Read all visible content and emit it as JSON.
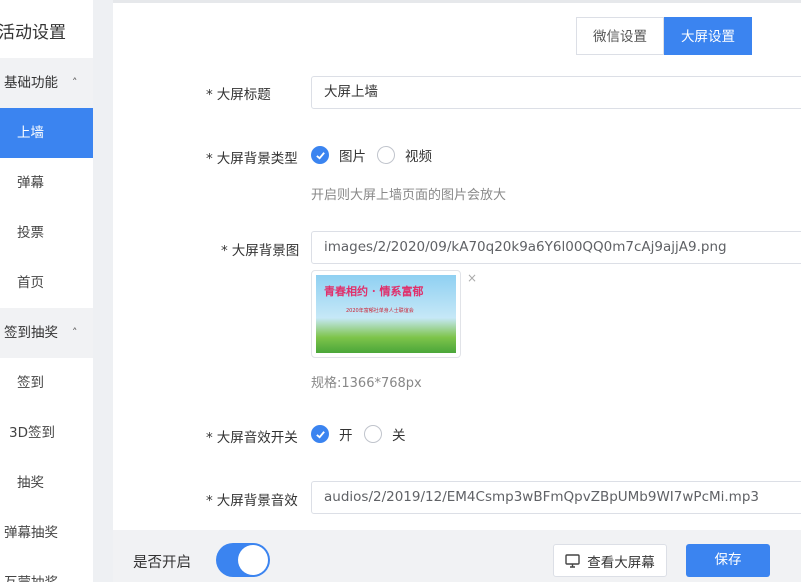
{
  "sidebar": {
    "title": "活动设置",
    "groups": [
      {
        "label": "基础功能",
        "chevron": "chevron-up-icon"
      },
      {
        "label": "签到抽奖",
        "chevron": "chevron-up-icon"
      }
    ],
    "items": [
      "上墙",
      "弹幕",
      "投票",
      "首页",
      "签到",
      "3D签到",
      "抽奖",
      "弹幕抽奖",
      "互蒙抽奖"
    ]
  },
  "tabs": [
    "微信设置",
    "大屏设置"
  ],
  "form": {
    "title_label": "大屏标题",
    "title_value": "大屏上墙",
    "bg_type_label": "大屏背景类型",
    "bg_type_options": [
      "图片",
      "视频"
    ],
    "bg_type_hint": "开启则大屏上墙页面的图片会放大",
    "bg_image_label": "大屏背景图",
    "bg_image_value": "images/2/2020/09/kA70q20k9a6Y6l00QQ0m7cAj9ajjA9.png",
    "bg_image_thumb_text": "青春相约 · 情系富郁",
    "bg_image_thumb_sub": "2020年富郁社单身人士联谊会",
    "bg_image_spec": "规格:1366*768px",
    "sound_switch_label": "大屏音效开关",
    "sound_switch_options": [
      "开",
      "关"
    ],
    "bg_sound_label": "大屏背景音效",
    "bg_sound_value": "audios/2/2019/12/EM4Csmp3wBFmQpvZBpUMb9WI7wPcMi.mp3"
  },
  "footer": {
    "enable_label": "是否开启",
    "view_button": "查看大屏幕",
    "save_button": "保存"
  },
  "colors": {
    "accent": "#3b84f0"
  }
}
